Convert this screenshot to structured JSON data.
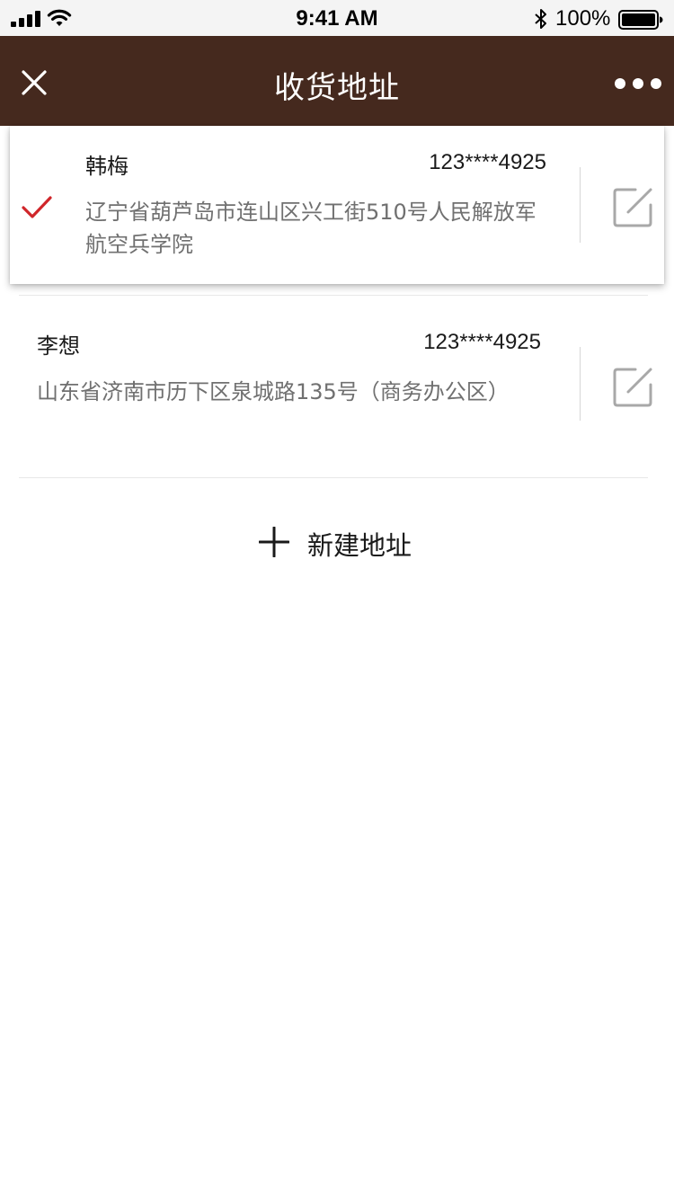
{
  "status_bar": {
    "time": "9:41 AM",
    "battery_percent": "100%",
    "battery_level": 1.0,
    "signal_bars": 4
  },
  "nav": {
    "title": "收货地址",
    "close_icon": "close-icon",
    "more_icon": "more-icon"
  },
  "addresses": [
    {
      "name": "韩梅",
      "phone": "123****4925",
      "address_line1": "辽宁省葫芦岛市连山区兴工街510号人民解放军",
      "address_line2": "航空兵学院",
      "selected": true
    },
    {
      "name": "李想",
      "phone": "123****4925",
      "address_line1": "山东省济南市历下区泉城路135号（商务办公区）",
      "selected": false
    }
  ],
  "new_address": {
    "label": "新建地址",
    "icon": "plus-icon"
  },
  "colors": {
    "nav_bg": "#45291e",
    "check": "#d0262a",
    "edit_icon": "#a8a8a8",
    "address_text": "#707070"
  }
}
